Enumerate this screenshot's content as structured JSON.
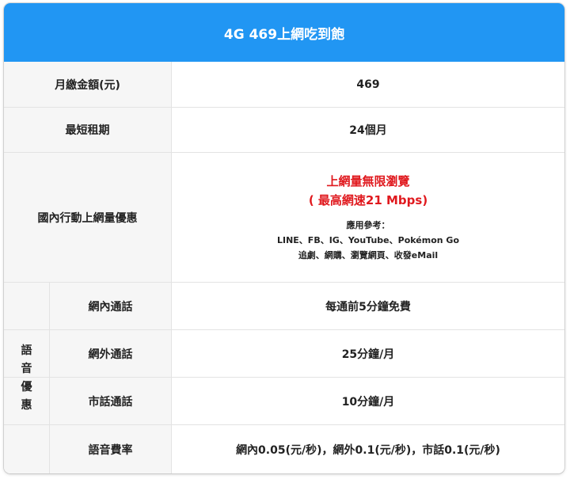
{
  "header": {
    "title": "4G 469上網吃到飽"
  },
  "rows": {
    "monthly_fee": {
      "label": "月繳金額(元)",
      "value": "469"
    },
    "min_term": {
      "label": "最短租期",
      "value": "24個月"
    },
    "data": {
      "label": "國內行動上網量優惠",
      "headline": "上網量無限瀏覽",
      "speed": "( 最高網速21 Mbps)",
      "ref_title": "應用參考：",
      "ref_line1": "LINE、FB、IG、YouTube、Pokémon Go",
      "ref_line2": "追劇、網購、瀏覽網頁、收發eMail"
    }
  },
  "voice": {
    "group_label": [
      "語",
      "音",
      "優",
      "惠"
    ],
    "items": [
      {
        "label": "網內通話",
        "value": "每通前5分鐘免費"
      },
      {
        "label": "網外通話",
        "value": "25分鐘/月"
      },
      {
        "label": "市話通話",
        "value": "10分鐘/月"
      },
      {
        "label": "語音費率",
        "value": "網內0.05(元/秒)，網外0.1(元/秒)，市話0.1(元/秒)"
      }
    ]
  },
  "colors": {
    "header_bg": "#2196f3",
    "highlight": "#e0191e",
    "label_bg": "#f6f6f6"
  }
}
